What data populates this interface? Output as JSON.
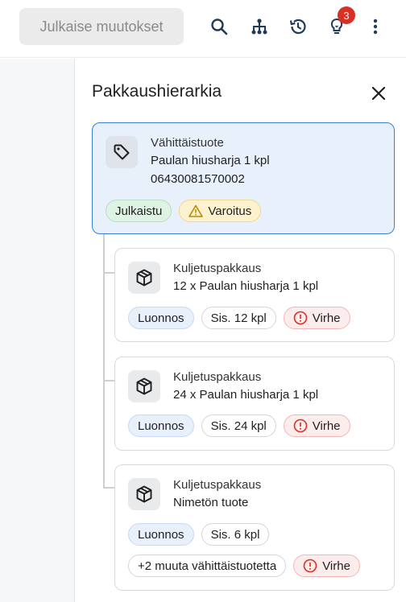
{
  "topbar": {
    "publish_label": "Julkaise muutokset",
    "notification_count": "3",
    "icons": [
      "search-icon",
      "hierarchy-icon",
      "history-icon",
      "lightbulb-icon",
      "more-vert-icon"
    ]
  },
  "panel": {
    "title": "Pakkaushierarkia"
  },
  "root": {
    "type": "Vähittäistuote",
    "name": "Paulan hiusharja 1 kpl",
    "gtin": "06430081570002",
    "status": "Julkaistu",
    "warning": "Varoitus"
  },
  "children": [
    {
      "type": "Kuljetuspakkaus",
      "name": "12 x Paulan hiusharja 1 kpl",
      "status": "Luonnos",
      "contains": "Sis. 12 kpl",
      "error": "Virhe"
    },
    {
      "type": "Kuljetuspakkaus",
      "name": "24 x Paulan hiusharja 1 kpl",
      "status": "Luonnos",
      "contains": "Sis. 24 kpl",
      "error": "Virhe"
    },
    {
      "type": "Kuljetuspakkaus",
      "name": "Nimetön tuote",
      "status": "Luonnos",
      "contains": "Sis. 6 kpl",
      "more": "+2 muuta vähittäistuotetta",
      "error": "Virhe"
    }
  ],
  "colors": {
    "root_bg": "#e8f0fb",
    "root_border": "#3b7dd8",
    "badge": "#d93025",
    "error": "#d93025",
    "warning": "#b98900",
    "icon": "#1f3a5a"
  }
}
